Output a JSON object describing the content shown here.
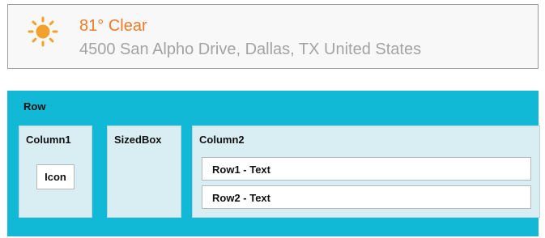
{
  "weather": {
    "icon": "sun-icon",
    "temperature": "81°",
    "condition": "Clear",
    "address": "4500 San Alpho Drive, Dallas, TX United States",
    "accent_color": "#f07b2a",
    "address_color": "#a3a3a3"
  },
  "diagram": {
    "row_label": "Row",
    "column1_label": "Column1",
    "icon_label": "Icon",
    "sizedbox_label": "SizedBox",
    "column2_label": "Column2",
    "row1_text": "Row1 - Text",
    "row2_text": "Row2 - Text",
    "row_color": "#11b9d6",
    "panel_color": "#d9eef3"
  }
}
